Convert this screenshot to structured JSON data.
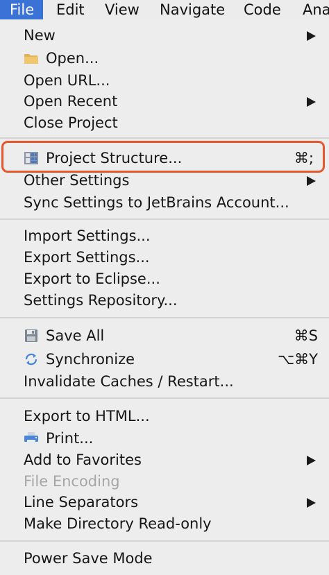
{
  "menubar": {
    "items": [
      "File",
      "Edit",
      "View",
      "Navigate",
      "Code",
      "Ana"
    ]
  },
  "menu": {
    "items": [
      {
        "label": "New",
        "submenu": true
      },
      {
        "label": "Open...",
        "icon": "folder-icon"
      },
      {
        "label": "Open URL..."
      },
      {
        "label": "Open Recent",
        "submenu": true
      },
      {
        "label": "Close Project"
      },
      {
        "label": "Project Structure...",
        "icon": "project-structure-icon",
        "shortcut": "⌘;",
        "highlighted": true
      },
      {
        "label": "Other Settings",
        "submenu": true
      },
      {
        "label": "Sync Settings to JetBrains Account..."
      },
      {
        "label": "Import Settings..."
      },
      {
        "label": "Export Settings..."
      },
      {
        "label": "Export to Eclipse..."
      },
      {
        "label": "Settings Repository..."
      },
      {
        "label": "Save All",
        "icon": "save-icon",
        "shortcut": "⌘S"
      },
      {
        "label": "Synchronize",
        "icon": "sync-icon",
        "shortcut": "⌥⌘Y"
      },
      {
        "label": "Invalidate Caches / Restart..."
      },
      {
        "label": "Export to HTML..."
      },
      {
        "label": "Print...",
        "icon": "printer-icon"
      },
      {
        "label": "Add to Favorites",
        "submenu": true
      },
      {
        "label": "File Encoding",
        "disabled": true
      },
      {
        "label": "Line Separators",
        "submenu": true
      },
      {
        "label": "Make Directory Read-only"
      },
      {
        "label": "Power Save Mode"
      }
    ]
  },
  "colors": {
    "menu_background": "#ededed",
    "active_menu_highlight": "#3a72d6",
    "annotation_outline": "#e8562e",
    "disabled_text": "#a6a6a6"
  }
}
